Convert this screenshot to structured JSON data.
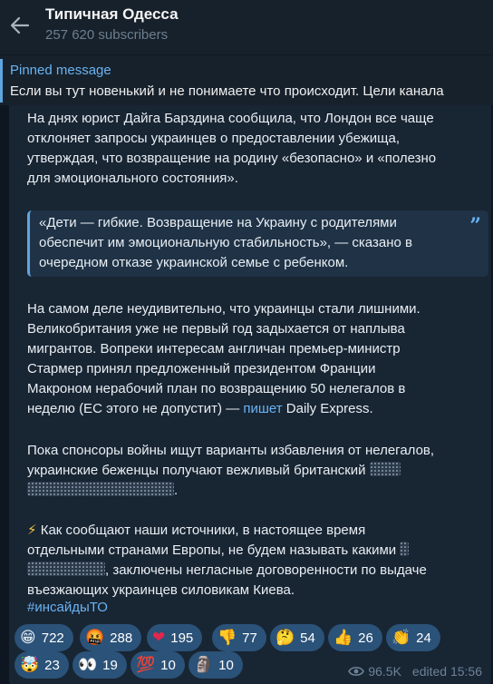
{
  "header": {
    "title": "Типичная Одесса",
    "subscribers": "257 620 subscribers"
  },
  "pinned": {
    "label": "Pinned message",
    "text": "Если вы тут новенький и не понимаете что происходит.  Цели канала"
  },
  "post": {
    "p1": [
      "На днях юрист Дайга Барздина сообщила, что Лондон все чаще",
      "отклоняет запросы украинцев о предоставлении убежища,",
      "утверждая, что возвращение на родину «безопасно» и «полезно",
      "для эмоционального состояния»."
    ],
    "quote": [
      "«Дети — гибкие. Возвращение на Украину с родителями",
      "обеспечит им эмоциональную стабильность», — сказано в",
      "очередном отказе украинской семье с ребенком."
    ],
    "p2": [
      "На самом деле неудивительно, что украинцы стали лишними.",
      "Великобритания уже не первый год задыхается от наплыва",
      "мигрантов. Вопреки интересам англичан премьер-министр",
      "Стармер принял предложенный президентом Франции",
      "Макроном нерабочий план по возвращению 50 нелегалов в"
    ],
    "p2_last_before": "неделю (ЕС этого не допустит) — ",
    "p2_link": "пишет",
    "p2_last_after": " Daily Express.",
    "p3_line1": "Пока спонсоры войны ищут варианты избавления от нелегалов,",
    "p3_line2": "украинские беженцы получают вежливый британский ",
    "p3_line3_end": ".",
    "p4_icon": "⚡",
    "p4_line1": " Как сообщают наши источники, в настоящее время",
    "p4_line2": "отдельными странами Европы, не будем называть какими ",
    "p4_line3_end": ", заключены негласные договоренности по выдаче",
    "p4_line4": "въезжающих украинцев силовикам Киева.",
    "hashtag": "#инсайдыТО"
  },
  "reactions": [
    {
      "emoji": "😁",
      "icon": "grinning-face-icon",
      "count": "722"
    },
    {
      "emoji": "🤬",
      "icon": "cursing-face-icon",
      "count": "288"
    },
    {
      "emoji": "❤",
      "icon": "red-heart-icon",
      "count": "195"
    },
    {
      "emoji": "👎",
      "icon": "thumbs-down-icon",
      "count": "77"
    },
    {
      "emoji": "🤔",
      "icon": "thinking-face-icon",
      "count": "54"
    },
    {
      "emoji": "👍",
      "icon": "thumbs-up-icon",
      "count": "26"
    },
    {
      "emoji": "👏",
      "icon": "clapping-hands-icon",
      "count": "24"
    },
    {
      "emoji": "🤯",
      "icon": "exploding-head-icon",
      "count": "23"
    },
    {
      "emoji": "👀",
      "icon": "eyes-icon",
      "count": "19"
    },
    {
      "emoji": "💯",
      "icon": "hundred-points-icon",
      "count": "10"
    },
    {
      "emoji": "🗿",
      "icon": "moai-icon",
      "count": "10"
    }
  ],
  "meta": {
    "views": "96.5K",
    "edited": "edited 15:56"
  },
  "colors": {
    "background": "#0e1621",
    "header": "#17212b",
    "bubble": "#182533",
    "accent": "#6ab3f3",
    "reaction": "#2b5278"
  }
}
